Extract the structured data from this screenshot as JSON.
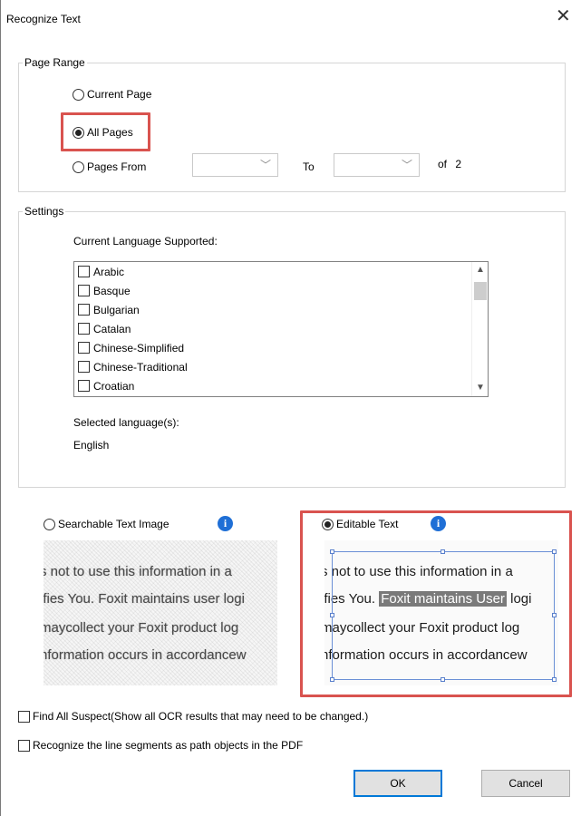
{
  "dialog": {
    "title": "Recognize Text",
    "close_glyph": "✕"
  },
  "page_range": {
    "legend": "Page Range",
    "options": {
      "current_page": "Current Page",
      "all_pages": "All Pages",
      "pages_from": "Pages From"
    },
    "selected": "all_pages",
    "to_label": "To",
    "of_label": "of",
    "total_pages": "2"
  },
  "settings": {
    "legend": "Settings",
    "language_list_label": "Current Language Supported:",
    "languages": [
      "Arabic",
      "Basque",
      "Bulgarian",
      "Catalan",
      "Chinese-Simplified",
      "Chinese-Traditional",
      "Croatian"
    ],
    "selected_label": "Selected language(s):",
    "selected_value": "English"
  },
  "output": {
    "searchable_label": "Searchable Text Image",
    "editable_label": "Editable Text",
    "selected": "editable",
    "preview_lines": [
      "s not to use this information in a",
      "ifies You. Foxit maintains user logi",
      "maycollect your Foxit product log",
      "nformation occurs in accordancew"
    ],
    "editable_preview": {
      "line1": "s not to use this information in a",
      "line2_a": "ifies You. ",
      "line2_highlight": "Foxit maintains User",
      "line2_b": " logi",
      "line3": "maycollect your Foxit product log",
      "line4": "nformation occurs in accordancew"
    }
  },
  "options": {
    "find_all_suspect": "Find All Suspect(Show all OCR results that may need to be changed.)",
    "line_segments": "Recognize the line segments as path objects in the PDF"
  },
  "buttons": {
    "ok": "OK",
    "cancel": "Cancel"
  },
  "colors": {
    "highlight_red": "#d9534f",
    "info_blue": "#1f6fd6"
  }
}
